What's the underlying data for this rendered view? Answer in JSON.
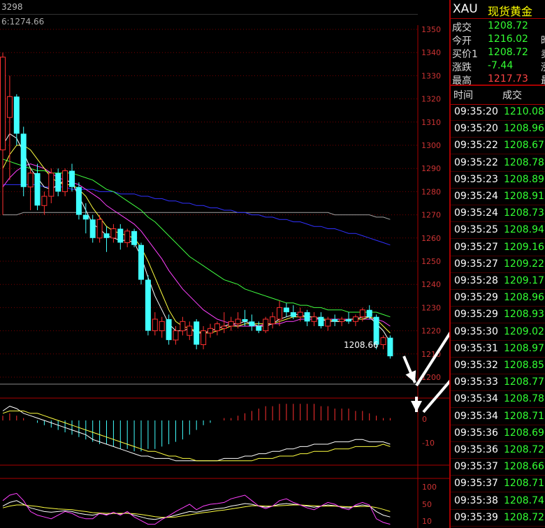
{
  "chart_header": {
    "top_left_value": "3298",
    "ma_label": "6:1274.66"
  },
  "price_annotation": "1208.66",
  "price_axis_labels": [
    "1350",
    "1340",
    "1330",
    "1320",
    "1310",
    "1300",
    "1290",
    "1280",
    "1270",
    "1260",
    "1250",
    "1240",
    "1230",
    "1220",
    "1210",
    "1200"
  ],
  "macd_axis_labels": [
    "0",
    "-10"
  ],
  "kdj_axis_labels": [
    "100",
    "50",
    "10"
  ],
  "colors": {
    "up_candle": "#ff3030",
    "down_candle": "#40ffff",
    "ma_short": "#ffffff",
    "ma_5": "#ffff40",
    "ma_10": "#ff40ff",
    "ma_20": "#40ff40",
    "ma_60": "#3030ff",
    "ma_120": "#a0a0a0",
    "grid": "#7a0000"
  },
  "quote": {
    "code": "XAU",
    "name": "现货黄金",
    "rows": [
      {
        "label": "成交",
        "value": "1208.72",
        "color": "#3f3",
        "cut": ""
      },
      {
        "label": "今开",
        "value": "1216.02",
        "color": "#3f3",
        "cut": "昨"
      },
      {
        "label": "买价1",
        "value": "1208.72",
        "color": "#3f3",
        "cut": "卖"
      },
      {
        "label": "涨跌",
        "value": "-7.44",
        "color": "#3f3",
        "cut": "涨"
      },
      {
        "label": "最高",
        "value": "1217.73",
        "color": "#f44",
        "cut": "最"
      }
    ]
  },
  "tick_header": {
    "time": "时间",
    "price": "成交"
  },
  "ticks": [
    {
      "time": "09:35:20",
      "price": "1210.08"
    },
    {
      "time": "09:35:20",
      "price": "1208.96"
    },
    {
      "time": "09:35:22",
      "price": "1208.67"
    },
    {
      "time": "09:35:22",
      "price": "1208.78"
    },
    {
      "time": "09:35:23",
      "price": "1208.89"
    },
    {
      "time": "09:35:24",
      "price": "1208.91"
    },
    {
      "time": "09:35:24",
      "price": "1208.73"
    },
    {
      "time": "09:35:25",
      "price": "1208.94"
    },
    {
      "time": "09:35:27",
      "price": "1209.16"
    },
    {
      "time": "09:35:27",
      "price": "1209.22"
    },
    {
      "time": "09:35:28",
      "price": "1209.17"
    },
    {
      "time": "09:35:29",
      "price": "1208.96"
    },
    {
      "time": "09:35:29",
      "price": "1208.93"
    },
    {
      "time": "09:35:30",
      "price": "1209.02"
    },
    {
      "time": "09:35:31",
      "price": "1208.97"
    },
    {
      "time": "09:35:32",
      "price": "1208.85"
    },
    {
      "time": "09:35:33",
      "price": "1208.77"
    },
    {
      "time": "09:35:34",
      "price": "1208.78"
    },
    {
      "time": "09:35:34",
      "price": "1208.71"
    },
    {
      "time": "09:35:36",
      "price": "1208.69"
    },
    {
      "time": "09:35:36",
      "price": "1208.72"
    },
    {
      "time": "09:35:37",
      "price": "1208.66"
    },
    {
      "time": "09:35:37",
      "price": "1208.71"
    },
    {
      "time": "09:35:38",
      "price": "1208.74"
    },
    {
      "time": "09:35:39",
      "price": "1208.72"
    }
  ],
  "candles": [
    {
      "o": 1298,
      "h": 1340,
      "l": 1270,
      "c": 1338
    },
    {
      "o": 1312,
      "h": 1330,
      "l": 1285,
      "c": 1321
    },
    {
      "o": 1321,
      "h": 1322,
      "l": 1300,
      "c": 1305
    },
    {
      "o": 1305,
      "h": 1308,
      "l": 1278,
      "c": 1282
    },
    {
      "o": 1282,
      "h": 1290,
      "l": 1272,
      "c": 1288
    },
    {
      "o": 1288,
      "h": 1292,
      "l": 1272,
      "c": 1274
    },
    {
      "o": 1274,
      "h": 1280,
      "l": 1270,
      "c": 1278
    },
    {
      "o": 1278,
      "h": 1290,
      "l": 1275,
      "c": 1288
    },
    {
      "o": 1288,
      "h": 1290,
      "l": 1278,
      "c": 1280
    },
    {
      "o": 1280,
      "h": 1290,
      "l": 1278,
      "c": 1289
    },
    {
      "o": 1289,
      "h": 1292,
      "l": 1280,
      "c": 1282
    },
    {
      "o": 1282,
      "h": 1284,
      "l": 1268,
      "c": 1270
    },
    {
      "o": 1270,
      "h": 1275,
      "l": 1262,
      "c": 1268
    },
    {
      "o": 1268,
      "h": 1270,
      "l": 1258,
      "c": 1260
    },
    {
      "o": 1260,
      "h": 1270,
      "l": 1258,
      "c": 1268
    },
    {
      "o": 1262,
      "h": 1265,
      "l": 1254,
      "c": 1260
    },
    {
      "o": 1260,
      "h": 1266,
      "l": 1258,
      "c": 1264
    },
    {
      "o": 1264,
      "h": 1266,
      "l": 1255,
      "c": 1258
    },
    {
      "o": 1258,
      "h": 1264,
      "l": 1256,
      "c": 1263
    },
    {
      "o": 1263,
      "h": 1264,
      "l": 1256,
      "c": 1257
    },
    {
      "o": 1257,
      "h": 1258,
      "l": 1240,
      "c": 1242
    },
    {
      "o": 1242,
      "h": 1244,
      "l": 1218,
      "c": 1220
    },
    {
      "o": 1220,
      "h": 1228,
      "l": 1218,
      "c": 1225
    },
    {
      "o": 1220,
      "h": 1226,
      "l": 1217,
      "c": 1224
    },
    {
      "o": 1225,
      "h": 1227,
      "l": 1214,
      "c": 1216
    },
    {
      "o": 1216,
      "h": 1222,
      "l": 1214,
      "c": 1220
    },
    {
      "o": 1220,
      "h": 1226,
      "l": 1218,
      "c": 1224
    },
    {
      "o": 1218,
      "h": 1224,
      "l": 1216,
      "c": 1222
    },
    {
      "o": 1224,
      "h": 1225,
      "l": 1212,
      "c": 1214
    },
    {
      "o": 1214,
      "h": 1222,
      "l": 1212,
      "c": 1220
    },
    {
      "o": 1219,
      "h": 1223,
      "l": 1217,
      "c": 1221
    },
    {
      "o": 1220,
      "h": 1224,
      "l": 1218,
      "c": 1223
    },
    {
      "o": 1221,
      "h": 1228,
      "l": 1219,
      "c": 1222
    },
    {
      "o": 1222,
      "h": 1226,
      "l": 1220,
      "c": 1224
    },
    {
      "o": 1223,
      "h": 1228,
      "l": 1221,
      "c": 1225
    },
    {
      "o": 1225,
      "h": 1229,
      "l": 1222,
      "c": 1224
    },
    {
      "o": 1224,
      "h": 1227,
      "l": 1220,
      "c": 1222
    },
    {
      "o": 1222,
      "h": 1224,
      "l": 1219,
      "c": 1220
    },
    {
      "o": 1220,
      "h": 1226,
      "l": 1219,
      "c": 1225
    },
    {
      "o": 1223,
      "h": 1228,
      "l": 1221,
      "c": 1226
    },
    {
      "o": 1225,
      "h": 1233,
      "l": 1222,
      "c": 1230
    },
    {
      "o": 1230,
      "h": 1232,
      "l": 1226,
      "c": 1228
    },
    {
      "o": 1228,
      "h": 1231,
      "l": 1225,
      "c": 1226
    },
    {
      "o": 1226,
      "h": 1230,
      "l": 1224,
      "c": 1228
    },
    {
      "o": 1228,
      "h": 1229,
      "l": 1222,
      "c": 1224
    },
    {
      "o": 1224,
      "h": 1228,
      "l": 1222,
      "c": 1226
    },
    {
      "o": 1226,
      "h": 1228,
      "l": 1221,
      "c": 1222
    },
    {
      "o": 1222,
      "h": 1226,
      "l": 1220,
      "c": 1225
    },
    {
      "o": 1225,
      "h": 1227,
      "l": 1222,
      "c": 1224
    },
    {
      "o": 1224,
      "h": 1226,
      "l": 1222,
      "c": 1225
    },
    {
      "o": 1225,
      "h": 1228,
      "l": 1223,
      "c": 1224
    },
    {
      "o": 1224,
      "h": 1227,
      "l": 1222,
      "c": 1226
    },
    {
      "o": 1226,
      "h": 1230,
      "l": 1224,
      "c": 1229
    },
    {
      "o": 1229,
      "h": 1231,
      "l": 1225,
      "c": 1226
    },
    {
      "o": 1226,
      "h": 1227,
      "l": 1212,
      "c": 1214
    },
    {
      "o": 1214,
      "h": 1218,
      "l": 1212,
      "c": 1217
    },
    {
      "o": 1217,
      "h": 1218,
      "l": 1208,
      "c": 1209
    }
  ],
  "ma_lines": {
    "ma_short": [
      1300,
      1305,
      1303,
      1297,
      1290,
      1286,
      1282,
      1281,
      1283,
      1285,
      1284,
      1278,
      1272,
      1266,
      1264,
      1261,
      1260,
      1259,
      1259,
      1258,
      1252,
      1243,
      1235,
      1229,
      1223,
      1220,
      1220,
      1221,
      1219,
      1219,
      1220,
      1221,
      1222,
      1223,
      1223,
      1224,
      1223,
      1222,
      1222,
      1223,
      1225,
      1226,
      1227,
      1227,
      1226,
      1226,
      1225,
      1224,
      1224,
      1224,
      1225,
      1225,
      1226,
      1226,
      1223,
      1220,
      1215
    ],
    "ma_5": [
      1290,
      1296,
      1300,
      1300,
      1298,
      1294,
      1290,
      1286,
      1284,
      1283,
      1283,
      1281,
      1278,
      1273,
      1269,
      1265,
      1263,
      1262,
      1261,
      1260,
      1256,
      1250,
      1243,
      1236,
      1229,
      1224,
      1222,
      1221,
      1220,
      1219,
      1219,
      1220,
      1221,
      1222,
      1222,
      1223,
      1223,
      1223,
      1223,
      1223,
      1224,
      1225,
      1226,
      1226,
      1226,
      1226,
      1225,
      1225,
      1224,
      1224,
      1225,
      1225,
      1225,
      1226,
      1225,
      1222,
      1219
    ],
    "ma_10": [
      1282,
      1286,
      1289,
      1291,
      1292,
      1291,
      1290,
      1288,
      1286,
      1285,
      1284,
      1283,
      1281,
      1279,
      1277,
      1274,
      1272,
      1270,
      1268,
      1266,
      1263,
      1259,
      1255,
      1251,
      1246,
      1242,
      1238,
      1235,
      1232,
      1229,
      1227,
      1225,
      1224,
      1223,
      1222,
      1222,
      1222,
      1222,
      1223,
      1223,
      1223,
      1224,
      1224,
      1225,
      1225,
      1225,
      1225,
      1225,
      1225,
      1225,
      1225,
      1225,
      1225,
      1225,
      1225,
      1224,
      1222
    ],
    "ma_20": [
      1294,
      1293,
      1292,
      1291,
      1290,
      1289,
      1289,
      1288,
      1288,
      1288,
      1288,
      1287,
      1286,
      1285,
      1283,
      1281,
      1280,
      1278,
      1276,
      1274,
      1272,
      1269,
      1267,
      1264,
      1261,
      1258,
      1255,
      1252,
      1250,
      1248,
      1246,
      1244,
      1242,
      1241,
      1240,
      1238,
      1237,
      1236,
      1235,
      1234,
      1233,
      1232,
      1232,
      1231,
      1231,
      1230,
      1230,
      1229,
      1229,
      1229,
      1228,
      1228,
      1228,
      1228,
      1228,
      1227,
      1226
    ],
    "ma_60": [
      1283,
      1283,
      1283,
      1283,
      1283,
      1283,
      1282,
      1282,
      1282,
      1282,
      1281,
      1281,
      1281,
      1281,
      1280,
      1280,
      1280,
      1279,
      1279,
      1279,
      1278,
      1278,
      1277,
      1277,
      1276,
      1276,
      1275,
      1275,
      1274,
      1274,
      1273,
      1273,
      1272,
      1272,
      1271,
      1271,
      1270,
      1270,
      1269,
      1269,
      1268,
      1268,
      1267,
      1267,
      1266,
      1265,
      1265,
      1264,
      1264,
      1263,
      1262,
      1262,
      1261,
      1260,
      1259,
      1258,
      1257
    ],
    "ma_120": [
      1270,
      1270,
      1270,
      1271,
      1271,
      1271,
      1271,
      1271,
      1271,
      1271,
      1271,
      1271,
      1271,
      1271,
      1271,
      1271,
      1271,
      1271,
      1271,
      1271,
      1271,
      1271,
      1271,
      1271,
      1271,
      1271,
      1271,
      1271,
      1271,
      1271,
      1271,
      1271,
      1271,
      1271,
      1271,
      1271,
      1271,
      1271,
      1271,
      1271,
      1271,
      1271,
      1271,
      1271,
      1271,
      1271,
      1271,
      1271,
      1270,
      1270,
      1270,
      1270,
      1270,
      1270,
      1269,
      1269,
      1268
    ]
  },
  "macd": {
    "bars": [
      2,
      3,
      2,
      1,
      0,
      -1,
      -2,
      -3,
      -4,
      -5,
      -6,
      -7,
      -8,
      -9,
      -10,
      -10,
      -11,
      -12,
      -12,
      -13,
      -13,
      -12,
      -12,
      -11,
      -10,
      -9,
      -8,
      -6,
      -4,
      -2,
      -1,
      0,
      1,
      1,
      2,
      3,
      4,
      5,
      6,
      6,
      7,
      7,
      7,
      7,
      7,
      7,
      6,
      6,
      5,
      5,
      5,
      4,
      4,
      3,
      2,
      1,
      1
    ],
    "dif": [
      4,
      6,
      5,
      3,
      2,
      1,
      0,
      -1,
      -2,
      -3,
      -4,
      -5,
      -6,
      -8,
      -9,
      -10,
      -11,
      -12,
      -13,
      -14,
      -15,
      -15,
      -16,
      -16,
      -16,
      -17,
      -17,
      -17,
      -17,
      -17,
      -17,
      -17,
      -16,
      -16,
      -16,
      -15,
      -15,
      -14,
      -14,
      -13,
      -13,
      -12,
      -12,
      -11,
      -11,
      -10,
      -10,
      -10,
      -9,
      -9,
      -9,
      -8,
      -8,
      -9,
      -9,
      -9,
      -10
    ],
    "dea": [
      3,
      4,
      4,
      4,
      3,
      3,
      2,
      1,
      0,
      -1,
      -2,
      -3,
      -4,
      -5,
      -6,
      -7,
      -8,
      -9,
      -10,
      -11,
      -12,
      -13,
      -13,
      -14,
      -15,
      -15,
      -16,
      -16,
      -17,
      -17,
      -17,
      -17,
      -17,
      -17,
      -17,
      -17,
      -17,
      -16,
      -16,
      -16,
      -15,
      -15,
      -15,
      -14,
      -14,
      -13,
      -13,
      -13,
      -12,
      -12,
      -12,
      -11,
      -11,
      -11,
      -11,
      -10,
      -11
    ]
  },
  "kdj": {
    "k": [
      55,
      65,
      70,
      60,
      50,
      45,
      40,
      38,
      40,
      42,
      40,
      35,
      32,
      30,
      34,
      32,
      35,
      33,
      36,
      30,
      25,
      20,
      18,
      22,
      25,
      30,
      35,
      40,
      38,
      42,
      45,
      48,
      50,
      55,
      58,
      62,
      60,
      55,
      52,
      55,
      60,
      62,
      60,
      58,
      55,
      52,
      55,
      58,
      56,
      52,
      50,
      55,
      58,
      55,
      40,
      30,
      25
    ],
    "d": [
      50,
      55,
      58,
      58,
      56,
      54,
      51,
      49,
      47,
      46,
      45,
      42,
      40,
      37,
      36,
      35,
      35,
      35,
      35,
      34,
      32,
      29,
      26,
      24,
      24,
      25,
      28,
      31,
      34,
      37,
      39,
      42,
      44,
      47,
      50,
      53,
      56,
      56,
      55,
      55,
      56,
      57,
      58,
      58,
      57,
      56,
      55,
      55,
      55,
      54,
      53,
      53,
      54,
      54,
      51,
      46,
      40
    ],
    "j": [
      70,
      85,
      90,
      70,
      40,
      30,
      25,
      20,
      30,
      40,
      35,
      25,
      20,
      20,
      35,
      30,
      38,
      30,
      40,
      25,
      15,
      5,
      5,
      18,
      28,
      40,
      50,
      60,
      45,
      55,
      60,
      62,
      65,
      75,
      80,
      85,
      70,
      55,
      48,
      55,
      70,
      75,
      65,
      58,
      50,
      45,
      55,
      65,
      60,
      50,
      45,
      58,
      65,
      58,
      20,
      10,
      5
    ]
  }
}
